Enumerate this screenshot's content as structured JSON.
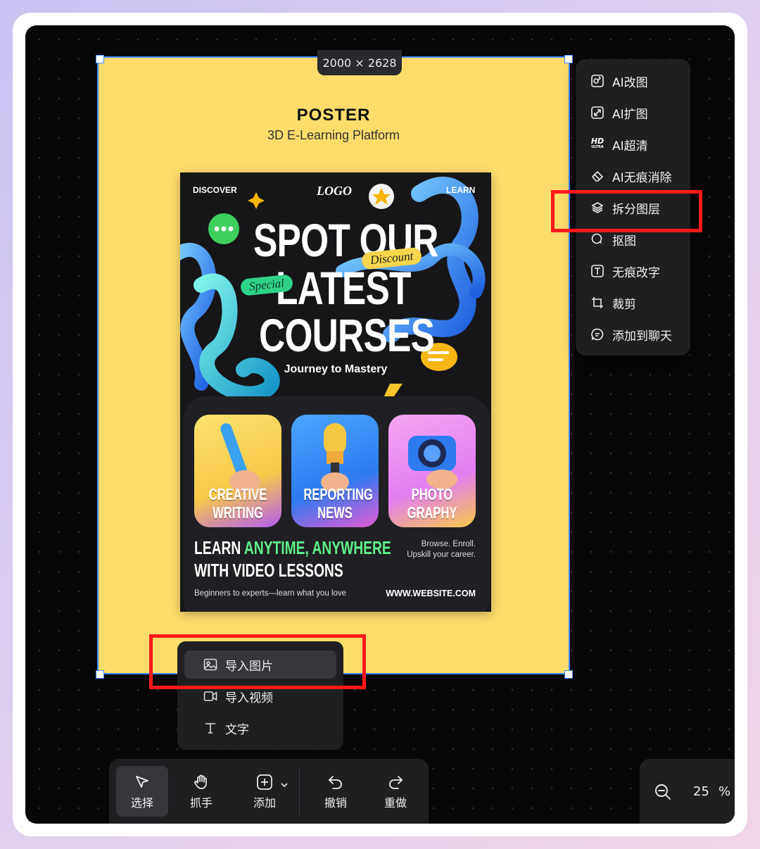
{
  "canvas": {
    "dimensions_label": "2000 × 2628"
  },
  "poster": {
    "heading": "POSTER",
    "subheading": "3D E-Learning Platform",
    "discover": "DISCOVER",
    "logo": "LOGO",
    "learn": "LEARN",
    "headline_1": "SPOT OUR",
    "headline_2": "LATEST",
    "headline_3": "COURSES",
    "tag_discount": "Discount",
    "tag_special": "Special",
    "journey": "Journey to Mastery",
    "courses": [
      {
        "label": "CREATIVE WRITING"
      },
      {
        "label": "REPORTING NEWS"
      },
      {
        "label": "PHOTO GRAPHY"
      }
    ],
    "learn_prefix": "LEARN ",
    "learn_highlight": "ANYTIME, ANYWHERE",
    "learn_line2": "WITH VIDEO LESSONS",
    "browse_line1": "Browse. Enroll.",
    "browse_line2": "Upskill your career.",
    "beginners": "Beginners to experts—learn what you love",
    "website": "WWW.WEBSITE.COM"
  },
  "context_menu": {
    "items": [
      {
        "label": "AI改图",
        "icon": "ai-edit-image-icon"
      },
      {
        "label": "AI扩图",
        "icon": "ai-expand-icon"
      },
      {
        "label": "AI超清",
        "icon": "hd-ultra-icon"
      },
      {
        "label": "AI无痕消除",
        "icon": "eraser-icon"
      },
      {
        "label": "拆分图层",
        "icon": "layers-icon"
      },
      {
        "label": "抠图",
        "icon": "cutout-icon"
      },
      {
        "label": "无痕改字",
        "icon": "text-edit-icon"
      },
      {
        "label": "裁剪",
        "icon": "crop-icon"
      },
      {
        "label": "添加到聊天",
        "icon": "chat-add-icon"
      }
    ],
    "hd_icon_text": "HD",
    "hd_icon_subtext": "ULTRA"
  },
  "add_menu": {
    "items": [
      {
        "label": "导入图片",
        "icon": "image-icon"
      },
      {
        "label": "导入视频",
        "icon": "video-icon"
      },
      {
        "label": "文字",
        "icon": "text-icon"
      }
    ]
  },
  "toolbar": {
    "select_label": "选择",
    "hand_label": "抓手",
    "add_label": "添加",
    "undo_label": "撤销",
    "redo_label": "重做"
  },
  "zoom": {
    "value": "25",
    "unit": "%"
  },
  "colors": {
    "artboard": "#fddc6c",
    "selection": "#3d86ff",
    "highlight_box": "#ff1a1a",
    "canvas_bg": "#070708",
    "menu_bg": "#1f1f22"
  }
}
